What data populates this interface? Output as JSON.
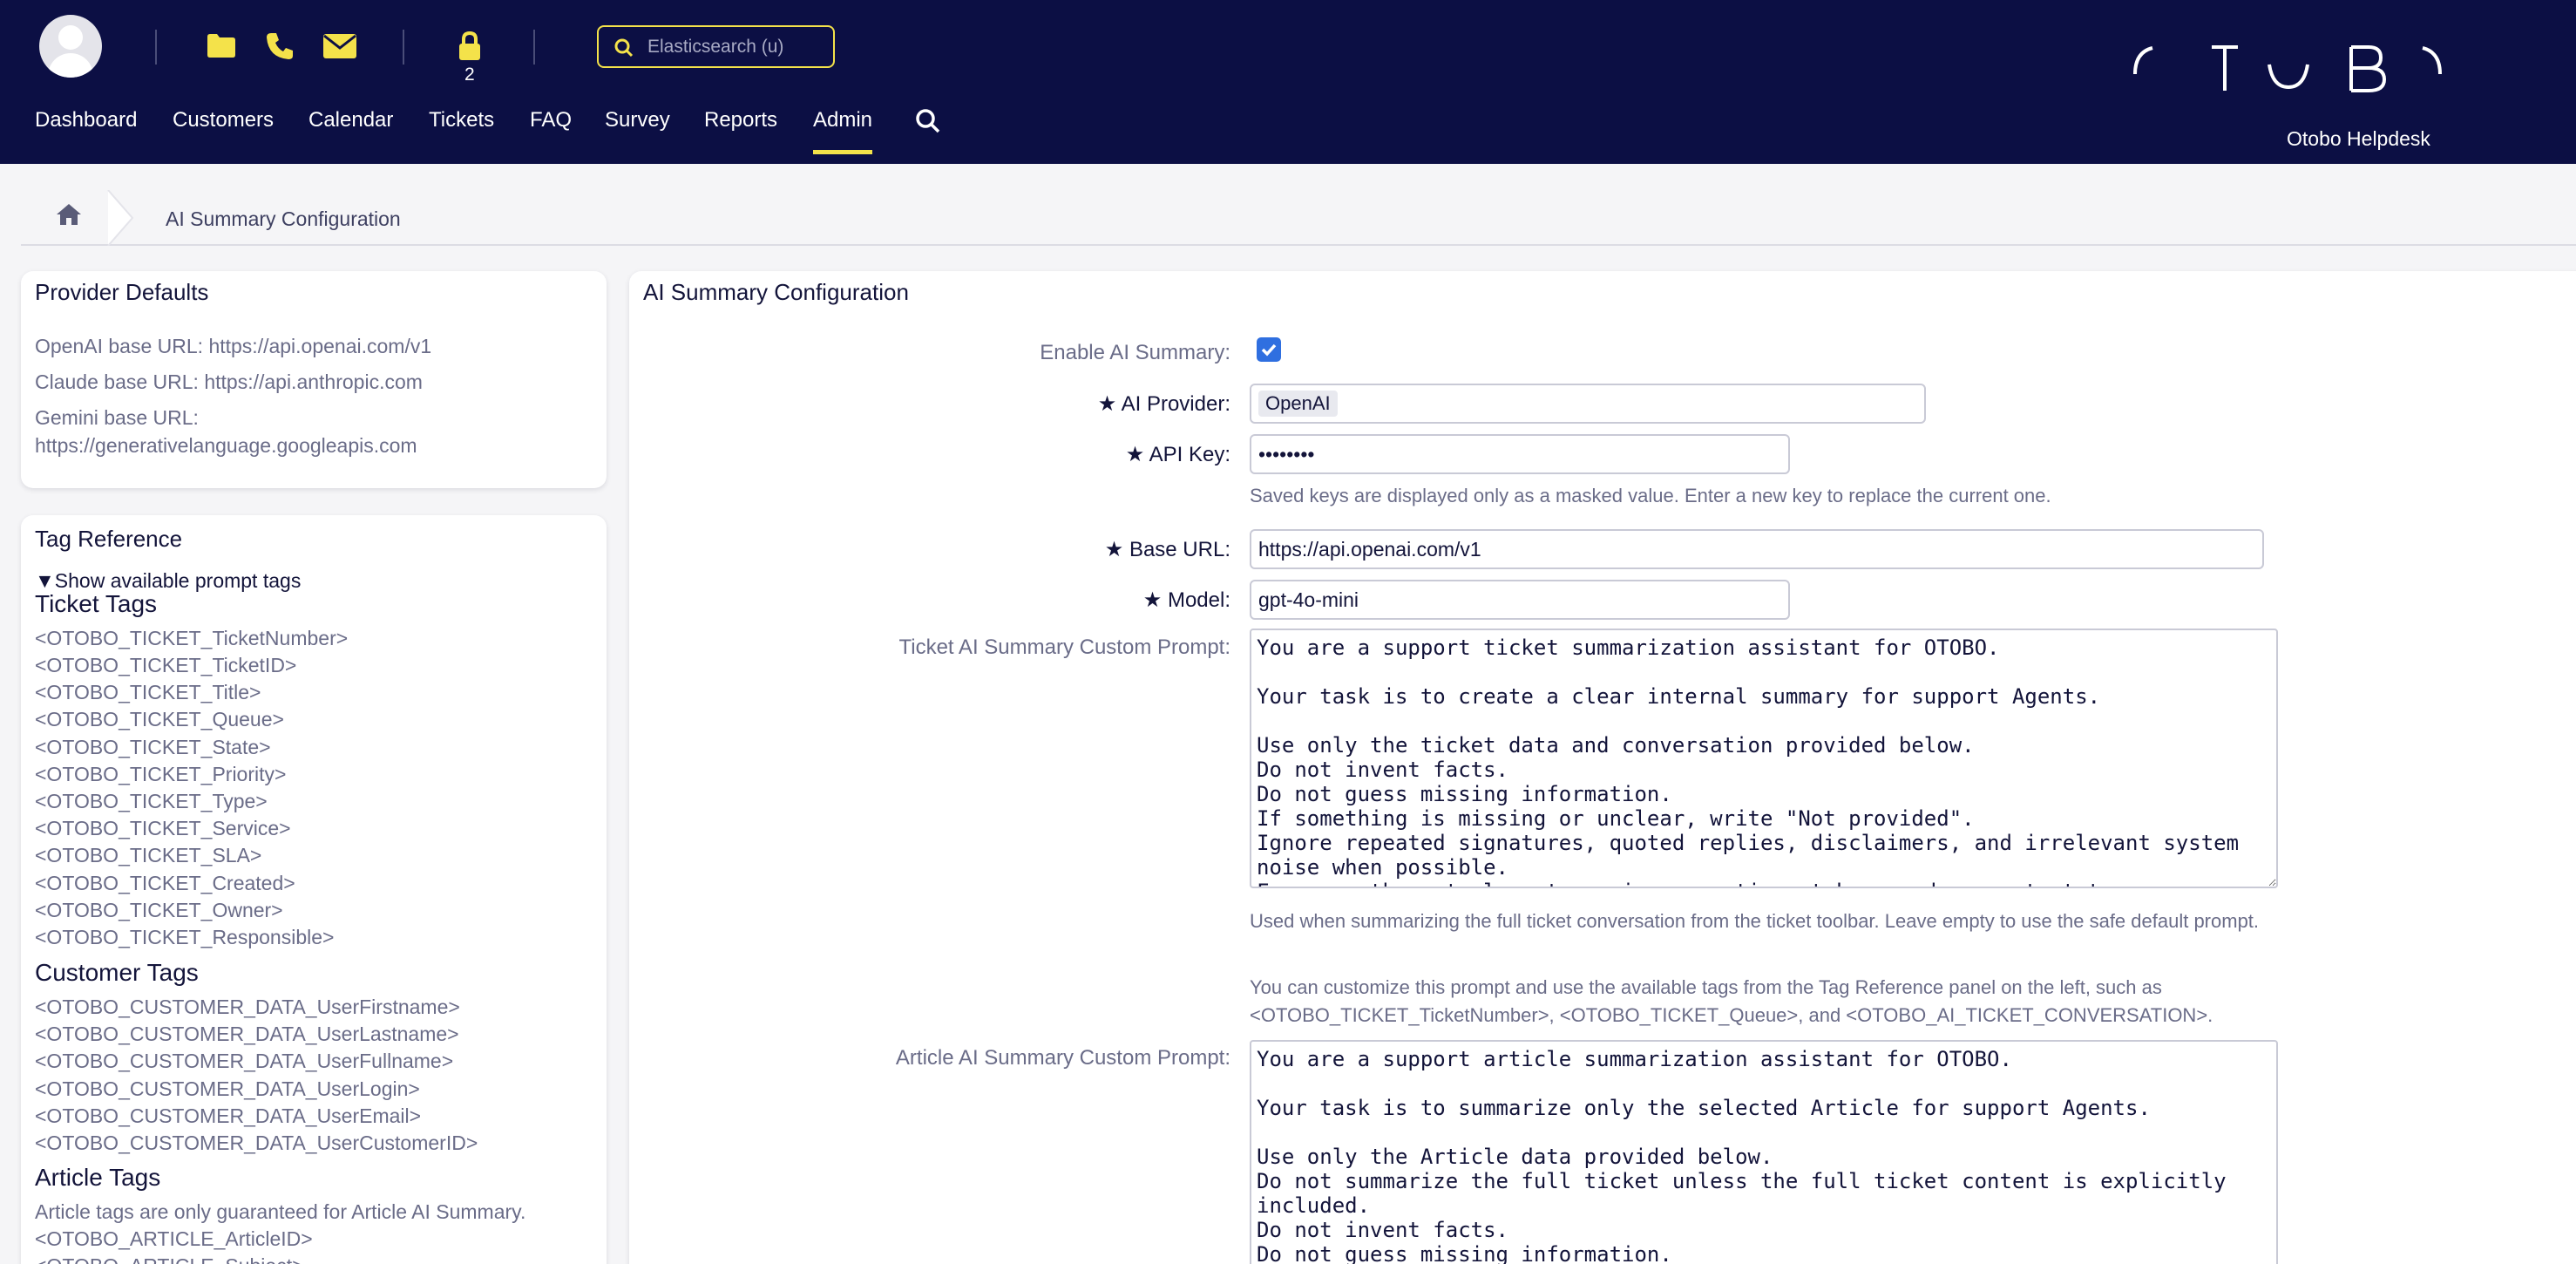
{
  "header": {
    "search_placeholder": "Elasticsearch (u)",
    "lock_count": "2",
    "brand": "Otobo Helpdesk",
    "logo_glyphs": [
      "(",
      "T",
      "‿",
      "B",
      ")"
    ],
    "icons": [
      "avatar-icon",
      "folder-icon",
      "phone-icon",
      "envelope-icon",
      "lock-icon",
      "search-icon"
    ],
    "accent_color": "#f4e24a",
    "bg_color": "#0c0f44"
  },
  "nav": {
    "items": [
      "Dashboard",
      "Customers",
      "Calendar",
      "Tickets",
      "FAQ",
      "Survey",
      "Reports",
      "Admin"
    ],
    "active": "Admin"
  },
  "breadcrumb": {
    "current": "AI Summary Configuration"
  },
  "provider_defaults": {
    "title": "Provider Defaults",
    "openai": "OpenAI base URL: https://api.openai.com/v1",
    "claude": "Claude base URL: https://api.anthropic.com",
    "gemini_label": "Gemini base URL:",
    "gemini_url": "https://generativelanguage.googleapis.com"
  },
  "tag_reference": {
    "title": "Tag Reference",
    "toggle": "Show available prompt tags",
    "ticket_heading": "Ticket Tags",
    "ticket_tags": [
      "<OTOBO_TICKET_TicketNumber>",
      "<OTOBO_TICKET_TicketID>",
      "<OTOBO_TICKET_Title>",
      "<OTOBO_TICKET_Queue>",
      "<OTOBO_TICKET_State>",
      "<OTOBO_TICKET_Priority>",
      "<OTOBO_TICKET_Type>",
      "<OTOBO_TICKET_Service>",
      "<OTOBO_TICKET_SLA>",
      "<OTOBO_TICKET_Created>",
      "<OTOBO_TICKET_Owner>",
      "<OTOBO_TICKET_Responsible>"
    ],
    "customer_heading": "Customer Tags",
    "customer_tags": [
      "<OTOBO_CUSTOMER_DATA_UserFirstname>",
      "<OTOBO_CUSTOMER_DATA_UserLastname>",
      "<OTOBO_CUSTOMER_DATA_UserFullname>",
      "<OTOBO_CUSTOMER_DATA_UserLogin>",
      "<OTOBO_CUSTOMER_DATA_UserEmail>",
      "<OTOBO_CUSTOMER_DATA_UserCustomerID>"
    ],
    "article_heading": "Article Tags",
    "article_note": "Article tags are only guaranteed for Article AI Summary.",
    "article_tags": [
      "<OTOBO_ARTICLE_ArticleID>",
      "<OTOBO_ARTICLE_Subject>"
    ]
  },
  "form": {
    "title": "AI Summary Configuration",
    "enable_label": "Enable AI Summary:",
    "enable_checked": true,
    "provider_label": "AI Provider:",
    "provider_value": "OpenAI",
    "apikey_label": "API Key:",
    "apikey_value": "••••••••",
    "apikey_help": "Saved keys are displayed only as a masked value. Enter a new key to replace the current one.",
    "baseurl_label": "Base URL:",
    "baseurl_value": "https://api.openai.com/v1",
    "model_label": "Model:",
    "model_value": "gpt-4o-mini",
    "ticket_prompt_label": "Ticket AI Summary Custom Prompt:",
    "ticket_prompt_value": "You are a support ticket summarization assistant for OTOBO.\n\nYour task is to create a clear internal summary for support Agents.\n\nUse only the ticket data and conversation provided below.\nDo not invent facts.\nDo not guess missing information.\nIf something is missing or unclear, write \"Not provided\".\nIgnore repeated signatures, quoted replies, disclaimers, and irrelevant system noise when possible.\nFocus on the actual customer issue, actions taken, and current status.",
    "ticket_prompt_help1": "Used when summarizing the full ticket conversation from the ticket toolbar. Leave empty to use the safe default prompt.",
    "ticket_prompt_help2": "You can customize this prompt and use the available tags from the Tag Reference panel on the left, such as <OTOBO_TICKET_TicketNumber>, <OTOBO_TICKET_Queue>, and <OTOBO_AI_TICKET_CONVERSATION>.",
    "article_prompt_label": "Article AI Summary Custom Prompt:",
    "article_prompt_value": "You are a support article summarization assistant for OTOBO.\n\nYour task is to summarize only the selected Article for support Agents.\n\nUse only the Article data provided below.\nDo not summarize the full ticket unless the full ticket content is explicitly included.\nDo not invent facts.\nDo not guess missing information.\nIf something is missing or unclear, write \"Not provided\"."
  }
}
